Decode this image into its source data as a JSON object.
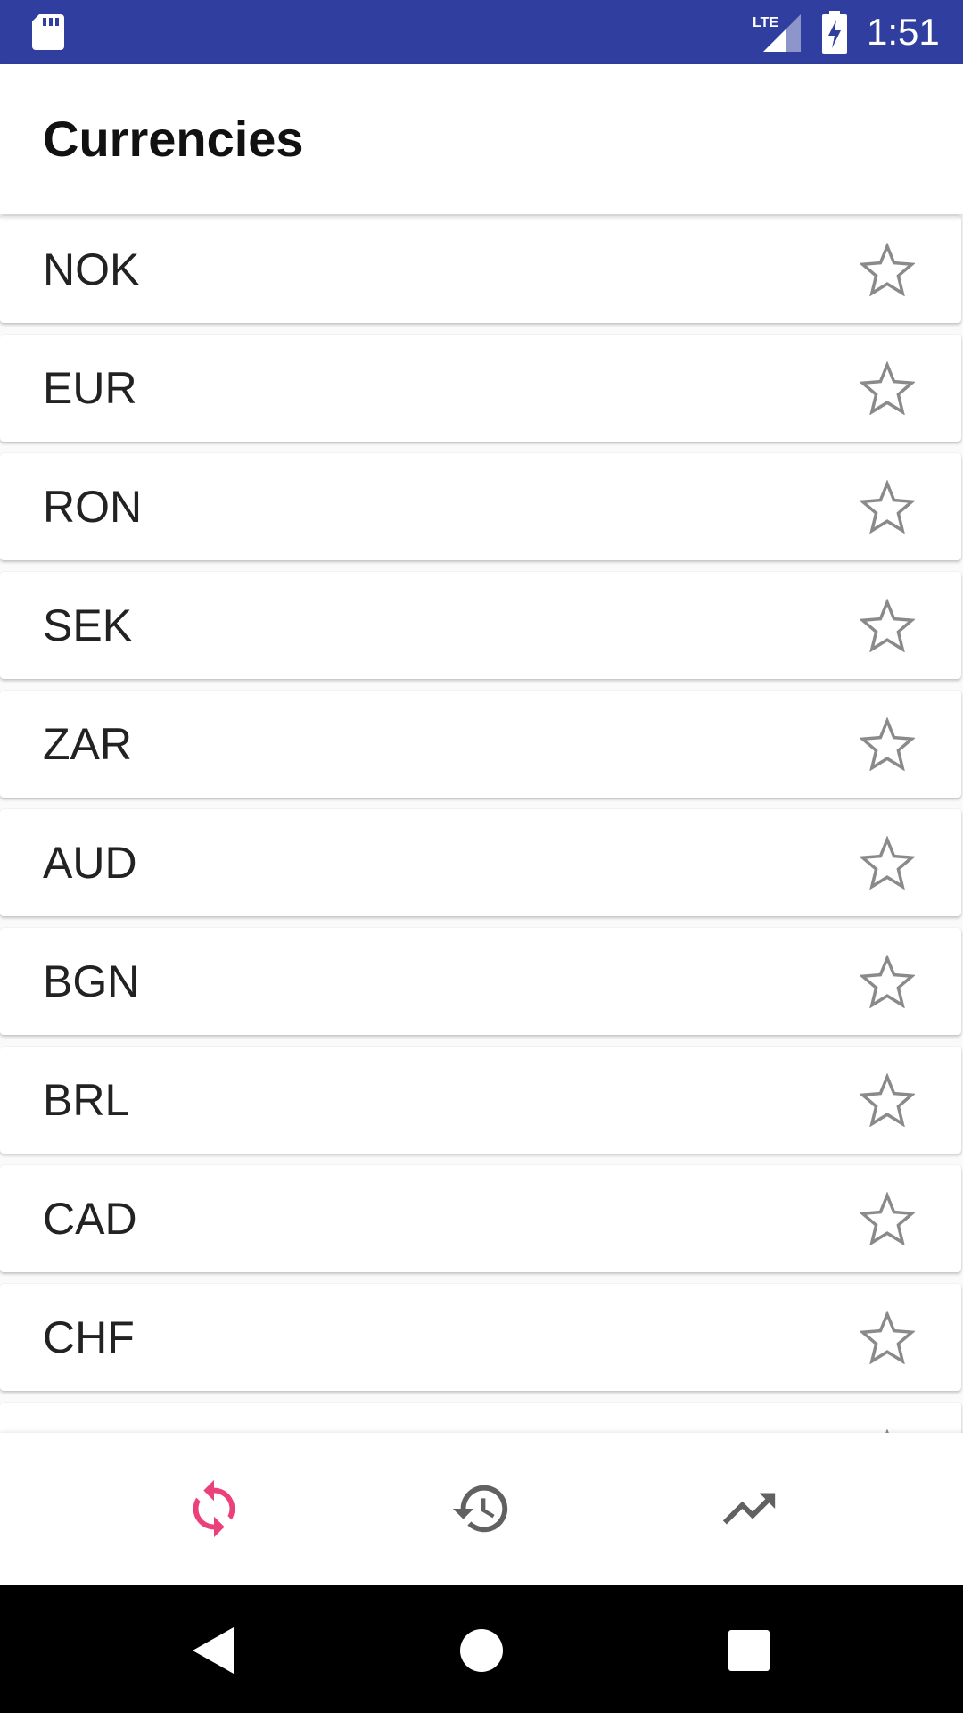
{
  "status_bar": {
    "time": "1:51",
    "network_label": "LTE",
    "sd_card_icon": "sd-card-icon",
    "signal_icon": "signal-lte-icon",
    "battery_icon": "battery-charging-icon",
    "background_color": "#303f9f"
  },
  "app_bar": {
    "title": "Currencies"
  },
  "currencies": [
    {
      "code": "NOK",
      "favorite": false
    },
    {
      "code": "EUR",
      "favorite": false
    },
    {
      "code": "RON",
      "favorite": false
    },
    {
      "code": "SEK",
      "favorite": false
    },
    {
      "code": "ZAR",
      "favorite": false
    },
    {
      "code": "AUD",
      "favorite": false
    },
    {
      "code": "BGN",
      "favorite": false
    },
    {
      "code": "BRL",
      "favorite": false
    },
    {
      "code": "CAD",
      "favorite": false
    },
    {
      "code": "CHF",
      "favorite": false
    }
  ],
  "bottom_nav": {
    "items": [
      {
        "icon": "sync-icon",
        "active": true
      },
      {
        "icon": "history-icon",
        "active": false
      },
      {
        "icon": "trending-up-icon",
        "active": false
      }
    ],
    "active_color": "#ec407a",
    "inactive_color": "#616161"
  },
  "system_nav": {
    "buttons": [
      "back-icon",
      "home-icon",
      "recents-icon"
    ]
  },
  "colors": {
    "star_outline": "#8a8a8a",
    "text_primary": "#222222"
  }
}
